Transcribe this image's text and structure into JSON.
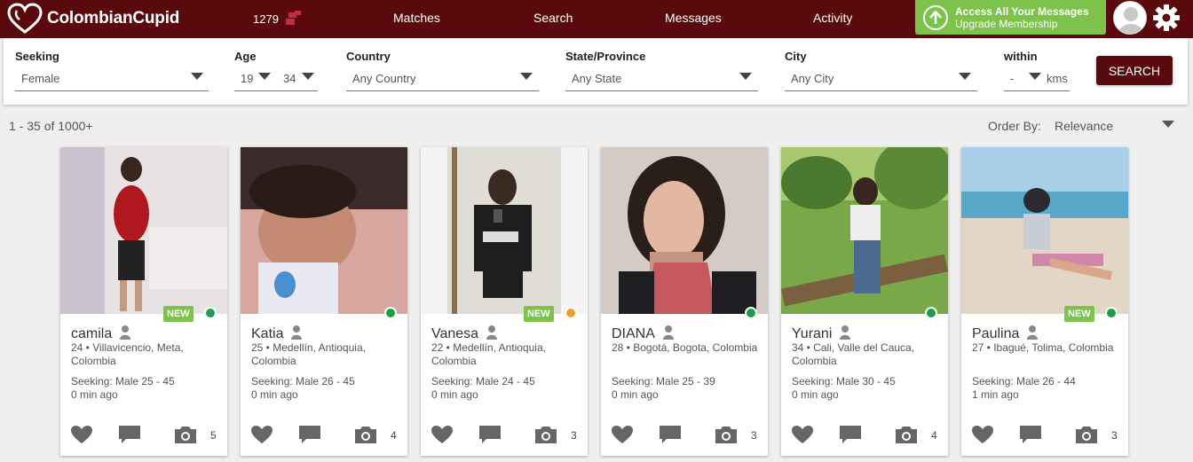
{
  "header": {
    "brand": "ColombianCupid",
    "count": "1279",
    "nav": [
      "Matches",
      "Search",
      "Messages",
      "Activity"
    ],
    "upgrade_line1": "Access All Your Messages",
    "upgrade_line2": "Upgrade Membership"
  },
  "filters": {
    "seeking_label": "Seeking",
    "seeking_value": "Female",
    "age_label": "Age",
    "age_min": "19",
    "age_max": "34",
    "country_label": "Country",
    "country_value": "Any Country",
    "state_label": "State/Province",
    "state_value": "Any State",
    "city_label": "City",
    "city_value": "Any City",
    "within_label": "within",
    "within_value": "-",
    "within_unit": "kms",
    "search_button": "SEARCH"
  },
  "results_text": "1 - 35 of 1000+",
  "order_by_label": "Order By:",
  "order_by_value": "Relevance",
  "colors": {
    "brand": "#5a0a0d",
    "accent_green": "#7cc24b",
    "online": "#1a9e4b",
    "away": "#f0a030"
  },
  "profiles": [
    {
      "name": "camila",
      "location": "24 • Villavicencio, Meta, Colombia",
      "seeking": "Seeking: Male 25 - 45",
      "last_active": "0 min ago",
      "photos": "5",
      "new_badge": "NEW",
      "status": "online"
    },
    {
      "name": "Katia",
      "location": "25 • Medellín, Antioquia, Colombia",
      "seeking": "Seeking: Male 26 - 45",
      "last_active": "0 min ago",
      "photos": "4",
      "new_badge": "",
      "status": "online"
    },
    {
      "name": "Vanesa",
      "location": "22 • Medellín, Antioquia, Colombia",
      "seeking": "Seeking: Male 24 - 45",
      "last_active": "0 min ago",
      "photos": "3",
      "new_badge": "NEW",
      "status": "away"
    },
    {
      "name": "DIANA",
      "location": "28 • Bogotá, Bogota, Colombia",
      "seeking": "Seeking: Male 25 - 39",
      "last_active": "0 min ago",
      "photos": "3",
      "new_badge": "",
      "status": "online"
    },
    {
      "name": "Yurani",
      "location": "34 • Cali, Valle del Cauca, Colombia",
      "seeking": "Seeking: Male 30 - 45",
      "last_active": "0 min ago",
      "photos": "4",
      "new_badge": "",
      "status": "online"
    },
    {
      "name": "Paulina",
      "location": "27 • Ibagué, Tolima, Colombia",
      "seeking": "Seeking: Male 26 - 44",
      "last_active": "1 min ago",
      "photos": "3",
      "new_badge": "NEW",
      "status": "online"
    }
  ]
}
